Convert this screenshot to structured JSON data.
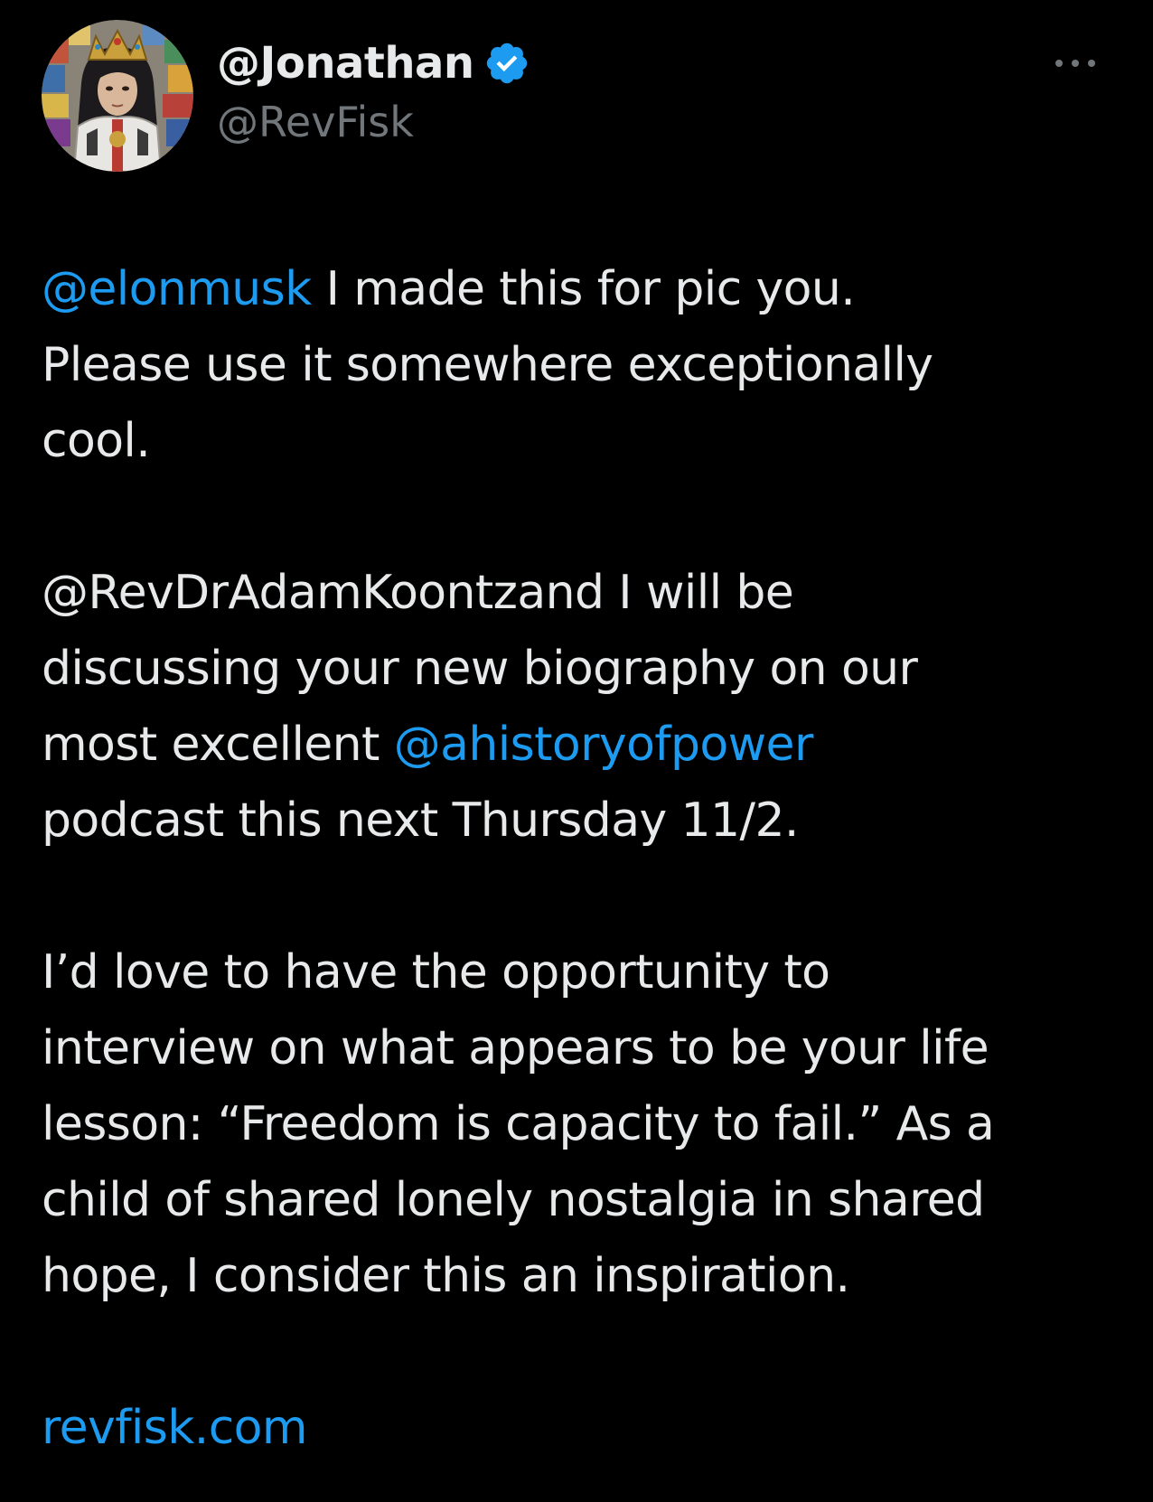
{
  "author": {
    "display_name": "@Jonathan",
    "handle": "@RevFisk",
    "avatar_icon": "avatar-image",
    "verified_icon": "verified-badge-icon"
  },
  "colors": {
    "background": "#000000",
    "text": "#e7e9ea",
    "secondary": "#71767b",
    "link": "#1d9bf0"
  },
  "tweet": {
    "p1": {
      "mention": "@elonmusk",
      "line1_rest": " I made this for pic you.",
      "line2": "Please use it somewhere exceptionally",
      "line3": "cool."
    },
    "p2": {
      "line1": "@RevDrAdamKoontzand I will be",
      "line2": "discussing your new biography on our",
      "line3_start": "most excellent ",
      "mention": "@ahistoryofpower",
      "line4": "podcast this next Thursday 11/2."
    },
    "p3": {
      "line1": "I’d love to have the opportunity to",
      "line2": "interview on what appears to be your life",
      "line3": "lesson: “Freedom is capacity to fail.” As a",
      "line4": "child of shared lonely nostalgia in shared",
      "line5": "hope, I consider this an inspiration."
    },
    "link": "revfisk.com"
  }
}
